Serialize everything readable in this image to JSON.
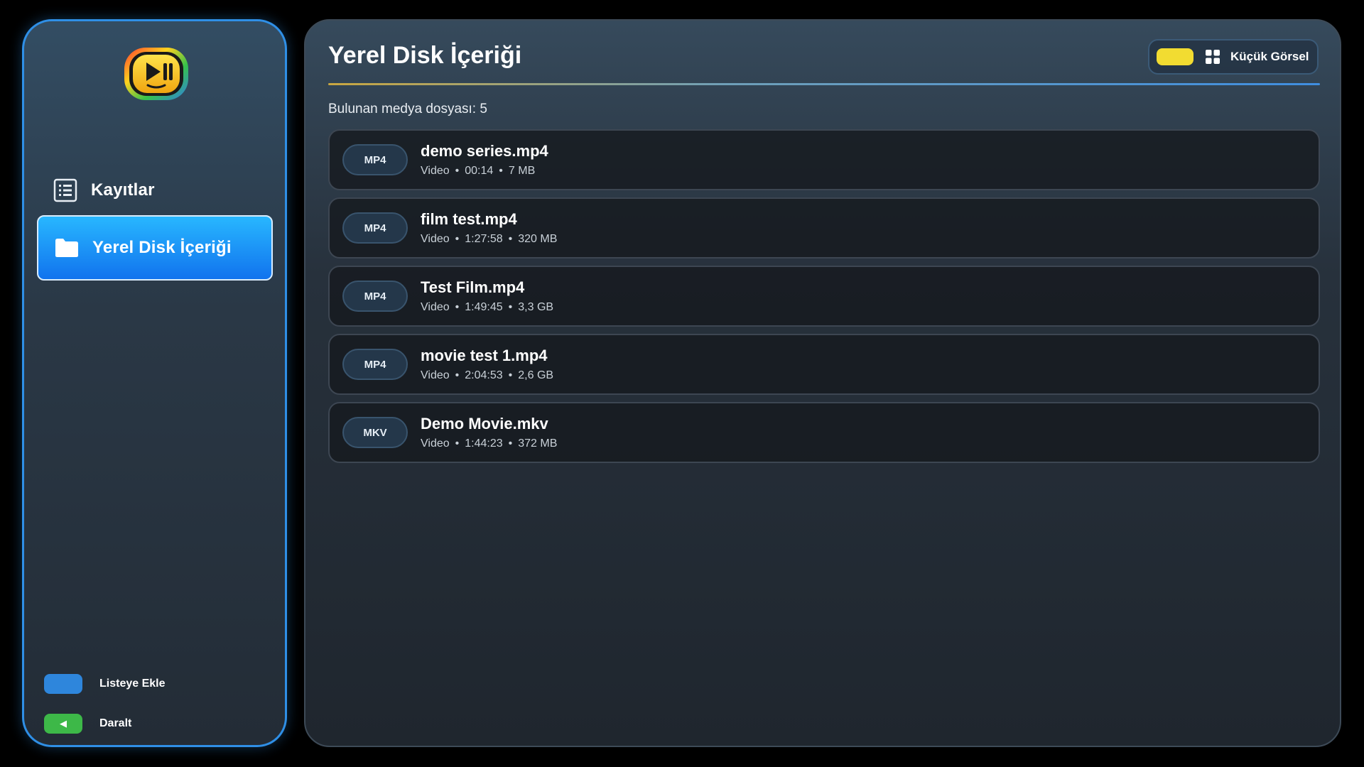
{
  "sidebar": {
    "logo_icon": "play-pause-logo-icon",
    "items": [
      {
        "label": "Kayıtlar",
        "icon": "list-icon",
        "active": false
      },
      {
        "label": "Yerel Disk İçeriği",
        "icon": "folder-icon",
        "active": true
      }
    ],
    "legend": {
      "add_label": "Listeye Ekle",
      "add_color": "#2e86dc",
      "collapse_label": "Daralt",
      "collapse_color": "#3db848",
      "collapse_symbol": "◀"
    }
  },
  "main": {
    "title": "Yerel Disk İçeriği",
    "view_toggle": {
      "label": "Küçük Görsel",
      "icon": "grid-icon",
      "indicator_color": "#f2dc31"
    },
    "count_text": "Bulunan medya dosyası: 5",
    "files": [
      {
        "ext": "MP4",
        "name": "demo series.mp4",
        "type": "Video",
        "duration": "00:14",
        "size": "7 MB"
      },
      {
        "ext": "MP4",
        "name": "film test.mp4",
        "type": "Video",
        "duration": "1:27:58",
        "size": "320 MB"
      },
      {
        "ext": "MP4",
        "name": "Test Film.mp4",
        "type": "Video",
        "duration": "1:49:45",
        "size": "3,3 GB"
      },
      {
        "ext": "MP4",
        "name": "movie test 1.mp4",
        "type": "Video",
        "duration": "2:04:53",
        "size": "2,6 GB"
      },
      {
        "ext": "MKV",
        "name": "Demo Movie.mkv",
        "type": "Video",
        "duration": "1:44:23",
        "size": "372 MB"
      }
    ]
  },
  "colors": {
    "accent_blue": "#2f8fe6",
    "active_item": "#1a8ff5"
  }
}
